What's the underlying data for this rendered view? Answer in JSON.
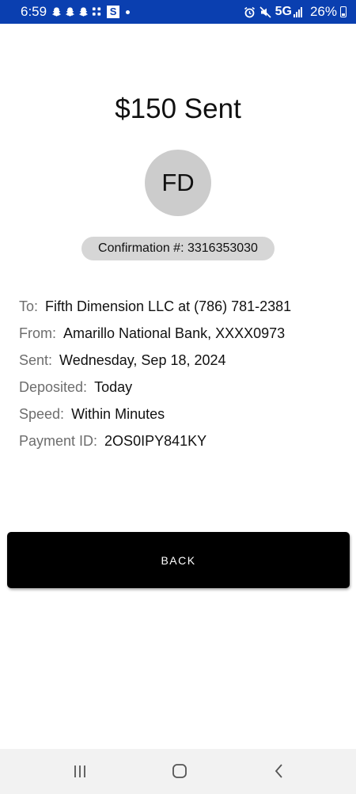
{
  "status": {
    "time": "6:59",
    "network": "5G",
    "battery": "26%",
    "app_badge": "S",
    "icons": [
      "snapchat-icon",
      "snapchat-icon",
      "snapchat-icon",
      "slack-icon",
      "s-app-icon",
      "more-dot-icon",
      "alarm-icon",
      "mute-icon",
      "signal-icon",
      "battery-icon"
    ]
  },
  "title": "$150 Sent",
  "avatar_initials": "FD",
  "confirmation": "Confirmation #: 3316353030",
  "details": [
    {
      "label": "To:",
      "value": "Fifth Dimension LLC at (786) 781-2381"
    },
    {
      "label": "From:",
      "value": "Amarillo National Bank, XXXX0973"
    },
    {
      "label": "Sent:",
      "value": "Wednesday, Sep 18, 2024"
    },
    {
      "label": "Deposited:",
      "value": "Today"
    },
    {
      "label": "Speed:",
      "value": "Within Minutes"
    },
    {
      "label": "Payment ID:",
      "value": "2OS0IPY841KY"
    }
  ],
  "back_label": "BACK",
  "nav": [
    "recent-apps-icon",
    "home-icon",
    "back-nav-icon"
  ],
  "colors": {
    "status_bar": "#0a3fb0",
    "button": "#000000",
    "pill": "#d6d6d6",
    "avatar": "#cccccc"
  }
}
